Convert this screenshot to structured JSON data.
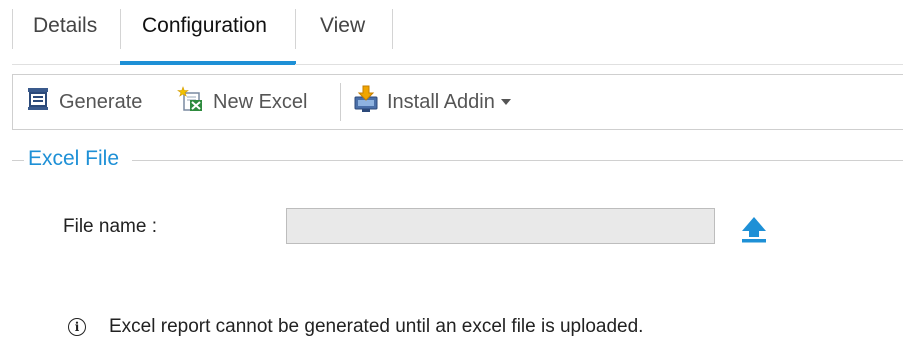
{
  "tabs": [
    {
      "label": "Details",
      "active": false
    },
    {
      "label": "Configuration",
      "active": true
    },
    {
      "label": "View",
      "active": false
    }
  ],
  "toolbar": {
    "generate_label": "Generate",
    "new_excel_label": "New Excel",
    "install_addin_label": "Install Addin"
  },
  "excel_file": {
    "group_title": "Excel File",
    "file_name_label": "File name :",
    "file_name_value": "",
    "info_message": "Excel report cannot be generated until an excel file is uploaded."
  },
  "colors": {
    "accent": "#1e90d6",
    "input_bg": "#e9e9e9"
  },
  "icons": [
    "generate-icon",
    "new-excel-icon",
    "install-addin-icon",
    "upload-icon",
    "info-icon"
  ]
}
